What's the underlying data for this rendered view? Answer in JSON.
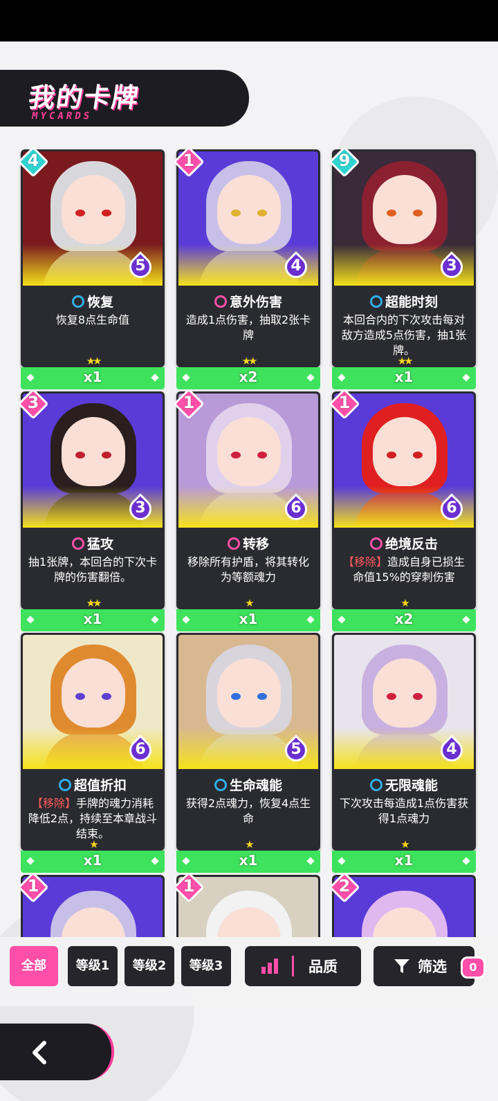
{
  "header": {
    "title": "我的卡牌",
    "subtitle": "MYCARDS"
  },
  "cards": [
    {
      "cost": "4",
      "cost_color": "#2fd3d0",
      "mana": "5",
      "name": "恢复",
      "type_color": "#2fb0e8",
      "desc_tag": "",
      "desc": "恢复8点生命值",
      "stars": "★★",
      "count": "x1",
      "art_bg": "#7a1a1f",
      "hair": "#d8d8dc",
      "eye": "#d02020"
    },
    {
      "cost": "1",
      "cost_color": "#ff4fa8",
      "mana": "4",
      "name": "意外伤害",
      "type_color": "#ff4fa8",
      "desc_tag": "",
      "desc": "造成1点伤害，抽取2张卡牌",
      "stars": "★★",
      "count": "x2",
      "art_bg": "#5a3bd8",
      "hair": "#c7bfe8",
      "eye": "#e0b030"
    },
    {
      "cost": "9",
      "cost_color": "#2fd3d0",
      "mana": "3",
      "name": "超能时刻",
      "type_color": "#2fb0e8",
      "desc_tag": "",
      "desc": "本回合内的下次攻击每对敌方造成5点伤害，抽1张牌。",
      "stars": "★★",
      "count": "x1",
      "art_bg": "#3a2a3a",
      "hair": "#8a2030",
      "eye": "#e06020"
    },
    {
      "cost": "3",
      "cost_color": "#ff4fa8",
      "mana": "3",
      "name": "猛攻",
      "type_color": "#ff4fa8",
      "desc_tag": "",
      "desc": "抽1张牌，本回合的下次卡牌的伤害翻倍。",
      "stars": "★★",
      "count": "x1",
      "art_bg": "#5a3bd8",
      "hair": "#2a1e1e",
      "eye": "#c02030"
    },
    {
      "cost": "1",
      "cost_color": "#ff4fa8",
      "mana": "6",
      "name": "转移",
      "type_color": "#ff4fa8",
      "desc_tag": "",
      "desc": "移除所有护盾，将其转化为等额魂力",
      "stars": "★",
      "count": "x1",
      "art_bg": "#b89ad8",
      "hair": "#e0d0ec",
      "eye": "#d02040"
    },
    {
      "cost": "1",
      "cost_color": "#ff4fa8",
      "mana": "6",
      "name": "绝境反击",
      "type_color": "#ff4fa8",
      "desc_tag": "【移除】",
      "desc": "造成自身已损生命值15%的穿刺伤害",
      "stars": "★",
      "count": "x2",
      "art_bg": "#5a3bd8",
      "hair": "#e02020",
      "eye": "#d02020"
    },
    {
      "cost": "",
      "cost_color": "",
      "mana": "6",
      "name": "超值折扣",
      "type_color": "#2fb0e8",
      "desc_tag": "【移除】",
      "desc": "手牌的魂力消耗降低2点，持续至本章战斗结束。",
      "stars": "★",
      "count": "x1",
      "art_bg": "#efe8c8",
      "hair": "#e08a30",
      "eye": "#6040d0"
    },
    {
      "cost": "",
      "cost_color": "",
      "mana": "5",
      "name": "生命魂能",
      "type_color": "#2fb0e8",
      "desc_tag": "",
      "desc": "获得2点魂力，恢复4点生命",
      "stars": "★",
      "count": "x1",
      "art_bg": "#d8b890",
      "hair": "#d8d4dc",
      "eye": "#3070e0"
    },
    {
      "cost": "",
      "cost_color": "",
      "mana": "4",
      "name": "无限魂能",
      "type_color": "#2fb0e8",
      "desc_tag": "",
      "desc": "下次攻击每造成1点伤害获得1点魂力",
      "stars": "★",
      "count": "x1",
      "art_bg": "#e8e4ee",
      "hair": "#c8b0e0",
      "eye": "#d02040"
    }
  ],
  "partial_cards": [
    {
      "cost": "1",
      "cost_color": "#ff4fa8",
      "art_bg": "#5a3bd8",
      "hair": "#c7bfe8"
    },
    {
      "cost": "1",
      "cost_color": "#ff4fa8",
      "art_bg": "#d8d0c0",
      "hair": "#f2f2f2"
    },
    {
      "cost": "2",
      "cost_color": "#ff4fa8",
      "art_bg": "#5a3bd8",
      "hair": "#e0b8f0"
    }
  ],
  "filters": {
    "all": "全部",
    "level1": "等级1",
    "level2": "等级2",
    "level3": "等级3",
    "quality": "品质",
    "filter": "筛选",
    "filter_count": "0"
  },
  "icons": {
    "back": "chevron-left-icon",
    "quality": "bar-chart-icon",
    "filter": "funnel-icon"
  }
}
